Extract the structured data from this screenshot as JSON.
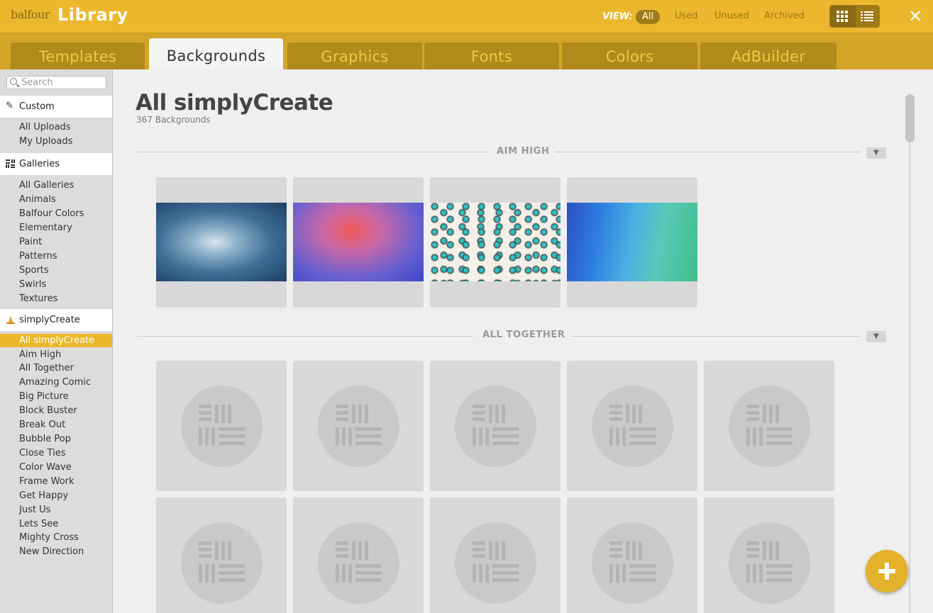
{
  "header": {
    "brand": "balfour",
    "title": "Library",
    "view_label": "VIEW:",
    "view_options": [
      "All",
      "Used",
      "Unused",
      "Archived"
    ],
    "view_selected": "All",
    "close": "✕"
  },
  "tabs": [
    "Templates",
    "Backgrounds",
    "Graphics",
    "Fonts",
    "Colors",
    "AdBuilder"
  ],
  "active_tab": "Backgrounds",
  "sidebar": {
    "search_placeholder": "Search",
    "sections": [
      {
        "label": "Custom",
        "icon": "pencil-icon",
        "items": [
          "All Uploads",
          "My Uploads"
        ]
      },
      {
        "label": "Galleries",
        "icon": "gallery-grid-icon",
        "items": [
          "All Galleries",
          "Animals",
          "Balfour Colors",
          "Elementary",
          "Paint",
          "Patterns",
          "Sports",
          "Swirls",
          "Textures"
        ]
      },
      {
        "label": "simplyCreate",
        "icon": "simplycreate-icon",
        "items": [
          "All simplyCreate",
          "Aim High",
          "All Together",
          "Amazing Comic",
          "Big Picture",
          "Block Buster",
          "Break Out",
          "Bubble Pop",
          "Close Ties",
          "Color Wave",
          "Frame Work",
          "Get Happy",
          "Just Us",
          "Lets See",
          "Mighty Cross",
          "New Direction"
        ]
      }
    ],
    "selected_item": "All simplyCreate"
  },
  "main": {
    "title": "All simplyCreate",
    "subtitle": "367 Backgrounds",
    "groups": [
      {
        "title": "AIM HIGH",
        "thumbnails": [
          "blue-cloud-texture",
          "purple-red-watercolor",
          "teal-leopard-print",
          "blue-green-geometric"
        ]
      },
      {
        "title": "ALL TOGETHER",
        "placeholders": 10
      }
    ]
  },
  "colors": {
    "accent": "#ebb72c",
    "tab_inactive": "#b08a1b",
    "tab_text": "#f1c745"
  }
}
